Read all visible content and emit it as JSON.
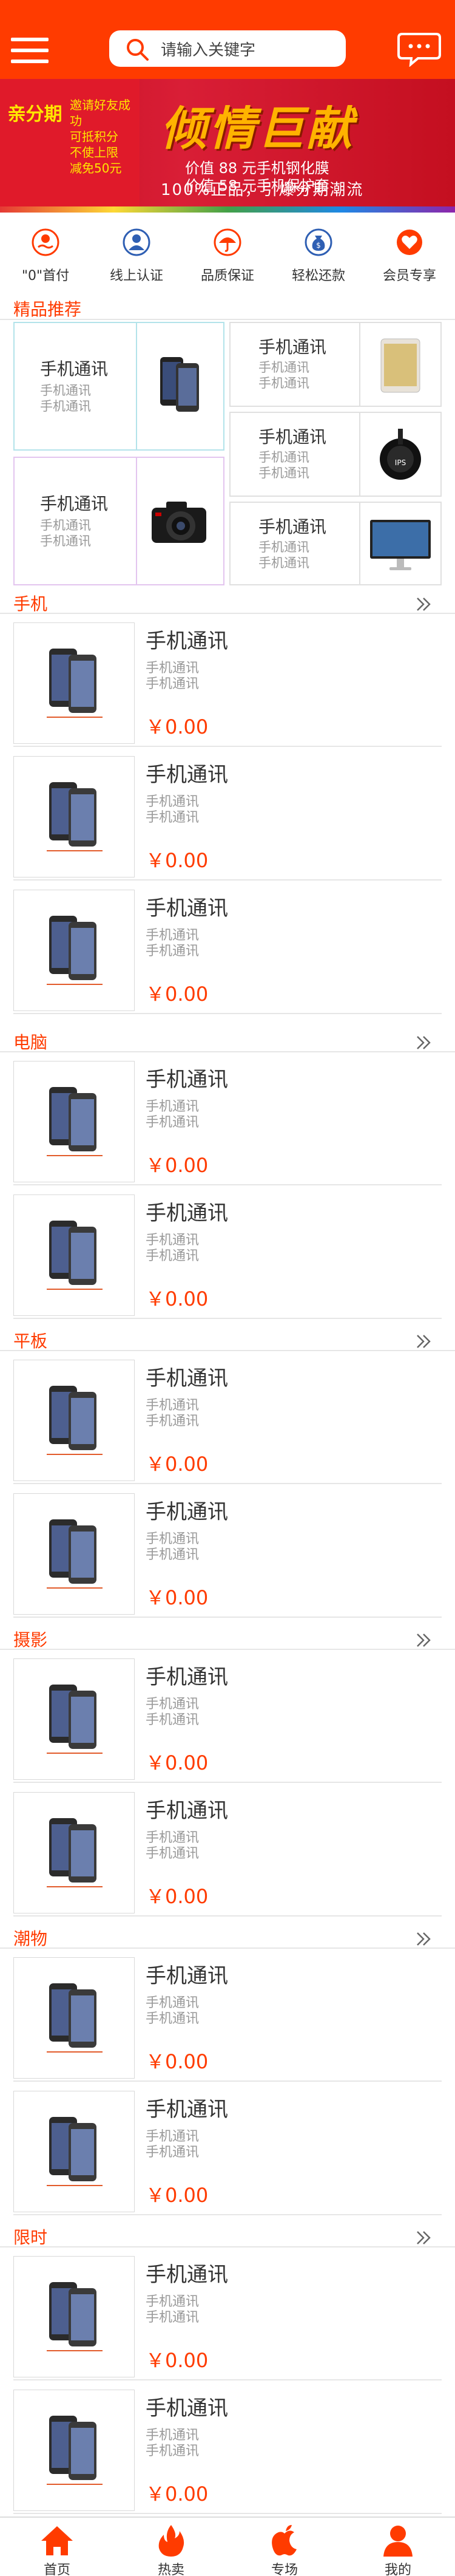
{
  "header": {
    "search_placeholder": "请输入关键字"
  },
  "banner": {
    "left_title": "亲分期",
    "left_lines": [
      "邀请好友成功",
      "可抵积分",
      "不使上限",
      "减免50元"
    ],
    "headline": "倾情巨献",
    "line1": "价值 88 元手机钢化膜",
    "line2": "价值 58 元手机保护套",
    "slogan": "100%正品，引爆分期潮流"
  },
  "quick_nav": [
    {
      "label": "\"0\"首付",
      "icon": "hand-coin-icon"
    },
    {
      "label": "线上认证",
      "icon": "user-icon"
    },
    {
      "label": "品质保证",
      "icon": "umbrella-icon"
    },
    {
      "label": "轻松还款",
      "icon": "money-bag-icon"
    },
    {
      "label": "会员专享",
      "icon": "heart-icon"
    }
  ],
  "featured": {
    "title": "精品推荐",
    "cards": [
      {
        "title": "手机通讯",
        "sub1": "手机通讯",
        "sub2": "手机通讯",
        "image": "iphone-image"
      },
      {
        "title": "手机通讯",
        "sub1": "手机通讯",
        "sub2": "手机通讯",
        "image": "ipad-image"
      },
      {
        "title": "手机通讯",
        "sub1": "手机通讯",
        "sub2": "手机通讯",
        "image": "unicycle-image"
      },
      {
        "title": "手机通讯",
        "sub1": "手机通讯",
        "sub2": "手机通讯",
        "image": "camera-image"
      },
      {
        "title": "手机通讯",
        "sub1": "手机通讯",
        "sub2": "手机通讯",
        "image": "monitor-image"
      }
    ]
  },
  "sections": [
    {
      "title": "手机",
      "items": [
        {
          "name": "手机通讯",
          "sub1": "手机通讯",
          "sub2": "手机通讯",
          "price": "￥0.00"
        },
        {
          "name": "手机通讯",
          "sub1": "手机通讯",
          "sub2": "手机通讯",
          "price": "￥0.00"
        },
        {
          "name": "手机通讯",
          "sub1": "手机通讯",
          "sub2": "手机通讯",
          "price": "￥0.00"
        }
      ]
    },
    {
      "title": "电脑",
      "items": [
        {
          "name": "手机通讯",
          "sub1": "手机通讯",
          "sub2": "手机通讯",
          "price": "￥0.00"
        },
        {
          "name": "手机通讯",
          "sub1": "手机通讯",
          "sub2": "手机通讯",
          "price": "￥0.00"
        }
      ]
    },
    {
      "title": "平板",
      "items": [
        {
          "name": "手机通讯",
          "sub1": "手机通讯",
          "sub2": "手机通讯",
          "price": "￥0.00"
        },
        {
          "name": "手机通讯",
          "sub1": "手机通讯",
          "sub2": "手机通讯",
          "price": "￥0.00"
        }
      ]
    },
    {
      "title": "摄影",
      "items": [
        {
          "name": "手机通讯",
          "sub1": "手机通讯",
          "sub2": "手机通讯",
          "price": "￥0.00"
        },
        {
          "name": "手机通讯",
          "sub1": "手机通讯",
          "sub2": "手机通讯",
          "price": "￥0.00"
        }
      ]
    },
    {
      "title": "潮物",
      "items": [
        {
          "name": "手机通讯",
          "sub1": "手机通讯",
          "sub2": "手机通讯",
          "price": "￥0.00"
        },
        {
          "name": "手机通讯",
          "sub1": "手机通讯",
          "sub2": "手机通讯",
          "price": "￥0.00"
        }
      ]
    },
    {
      "title": "限时",
      "items": [
        {
          "name": "手机通讯",
          "sub1": "手机通讯",
          "sub2": "手机通讯",
          "price": "￥0.00"
        },
        {
          "name": "手机通讯",
          "sub1": "手机通讯",
          "sub2": "手机通讯",
          "price": "￥0.00"
        }
      ]
    }
  ],
  "tabbar": [
    {
      "label": "首页",
      "icon": "home-icon"
    },
    {
      "label": "热卖",
      "icon": "fire-icon"
    },
    {
      "label": "专场",
      "icon": "apple-icon"
    },
    {
      "label": "我的",
      "icon": "person-icon"
    }
  ],
  "colors": {
    "brand": "#ff3b00",
    "banner": "#d91e36",
    "gold": "#ffb300"
  }
}
